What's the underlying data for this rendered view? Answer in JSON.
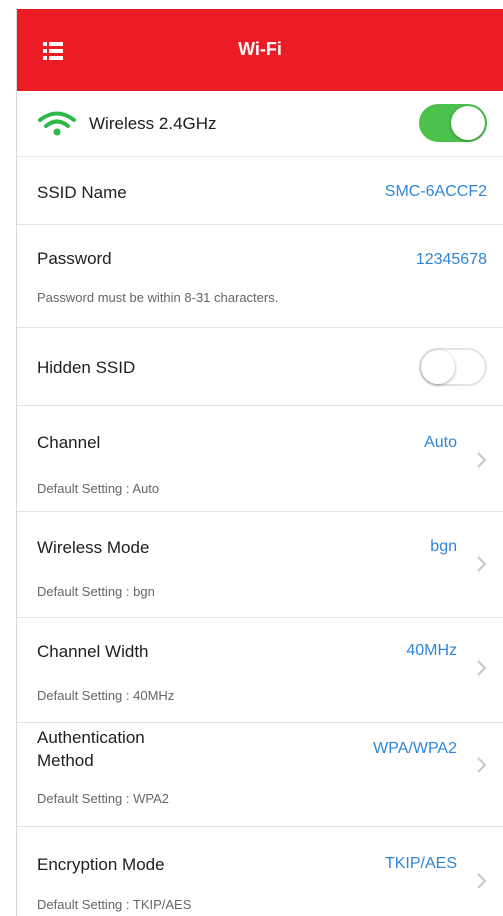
{
  "header": {
    "title": "Wi-Fi",
    "menu_icon": "list-menu-icon",
    "color": "#ec1c24"
  },
  "wireless": {
    "label": "Wireless 2.4GHz",
    "icon": "wifi-icon",
    "enabled": true
  },
  "ssid": {
    "label": "SSID Name",
    "value": "SMC-6ACCF2"
  },
  "password": {
    "label": "Password",
    "value": "12345678",
    "hint": "Password must be within 8-31 characters."
  },
  "hidden_ssid": {
    "label": "Hidden SSID",
    "enabled": false
  },
  "channel": {
    "label": "Channel",
    "value": "Auto",
    "hint": "Default Setting : Auto"
  },
  "wireless_mode": {
    "label": "Wireless Mode",
    "value": "bgn",
    "hint": "Default Setting : bgn"
  },
  "channel_width": {
    "label": "Channel Width",
    "value": "40MHz",
    "hint": "Default Setting : 40MHz"
  },
  "auth_method": {
    "label_line1": "Authentication",
    "label_line2": "Method",
    "value": "WPA/WPA2",
    "hint": "Default Setting : WPA2"
  },
  "encryption": {
    "label": "Encryption Mode",
    "value": "TKIP/AES",
    "hint": "Default Setting : TKIP/AES"
  },
  "colors": {
    "accent": "#2f86d6",
    "toggle_on": "#4cc14c"
  }
}
